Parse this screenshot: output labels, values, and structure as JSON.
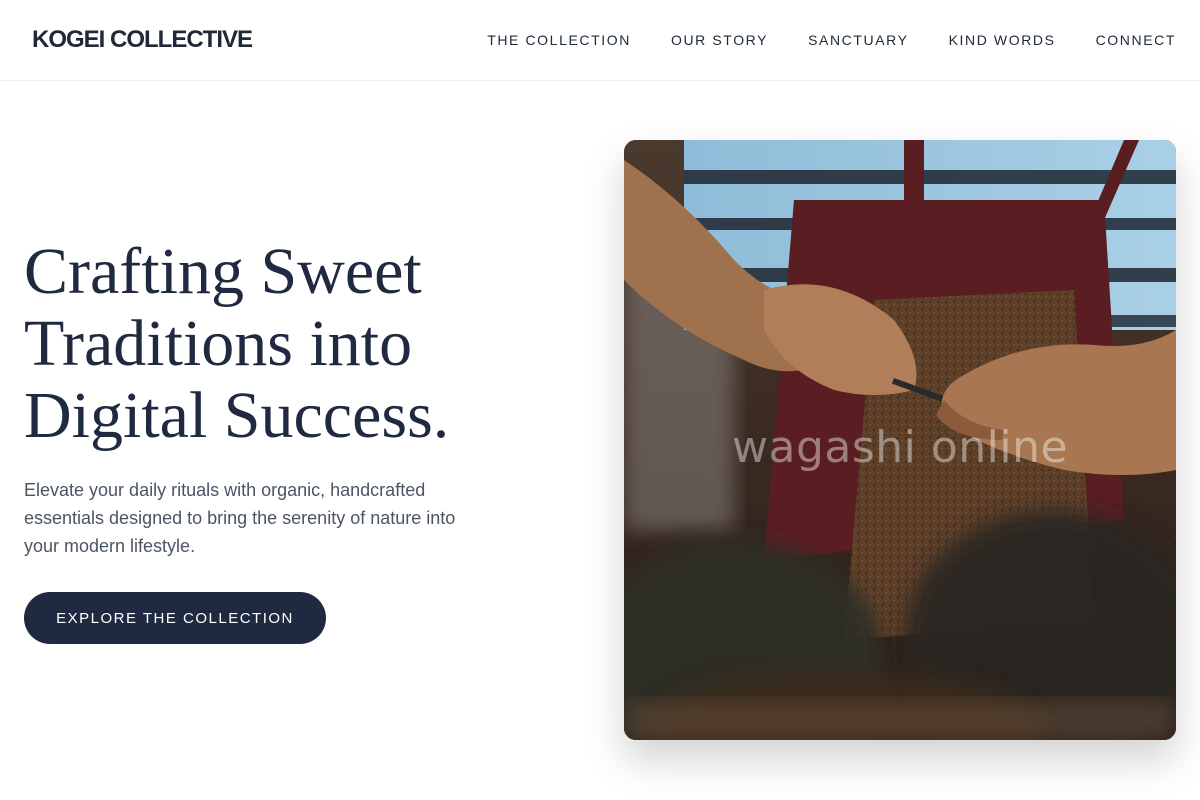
{
  "header": {
    "brand": "KOGEI COLLECTIVE",
    "nav": [
      {
        "label": "THE COLLECTION"
      },
      {
        "label": "OUR STORY"
      },
      {
        "label": "SANCTUARY"
      },
      {
        "label": "KIND WORDS"
      },
      {
        "label": "CONNECT"
      }
    ]
  },
  "hero": {
    "title": "Crafting Sweet Traditions into Digital Success.",
    "subtitle": "Elevate your daily rituals with organic, handcrafted essentials designed to bring the serenity of nature into your modern lifestyle.",
    "cta_label": "EXPLORE THE COLLECTION",
    "image": {
      "watermark": "wagashi online",
      "subject": "artisan hands carving on a wooden board"
    }
  },
  "colors": {
    "primary": "#1f2a40",
    "text": "#1f2937",
    "muted": "#4b5563",
    "background": "#ffffff"
  }
}
